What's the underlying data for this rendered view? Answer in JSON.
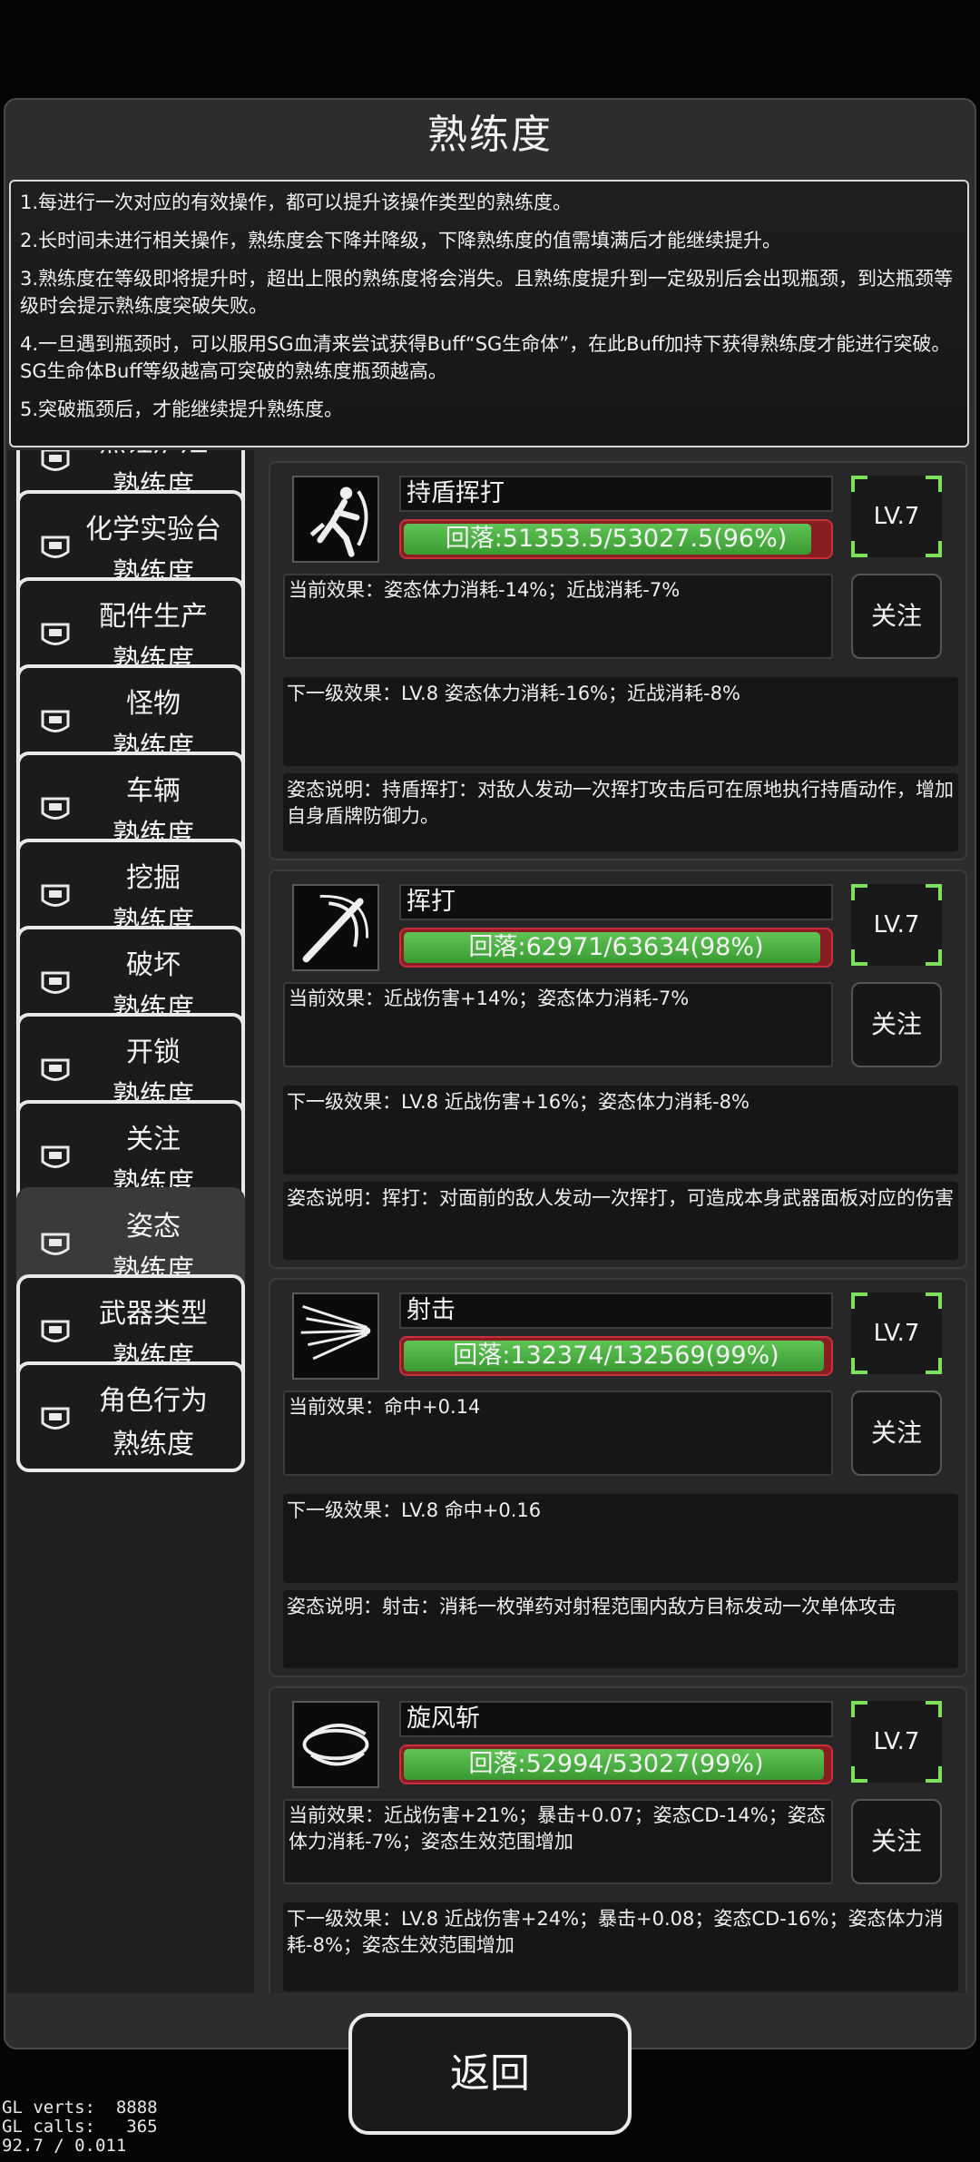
{
  "title": "熟练度",
  "info": [
    "1.每进行一次对应的有效操作，都可以提升该操作类型的熟练度。",
    "2.长时间未进行相关操作，熟练度会下降并降级，下降熟练度的值需填满后才能继续提升。",
    "3.熟练度在等级即将提升时，超出上限的熟练度将会消失。且熟练度提升到一定级别后会出现瓶颈，到达瓶颈等级时会提示熟练度突破失败。",
    "4.一旦遇到瓶颈时，可以服用SG血清来尝试获得Buff“SG生命体”，在此Buff加持下获得熟练度才能进行突破。SG生命体Buff等级越高可突破的熟练度瓶颈越高。",
    "5.突破瓶颈后，才能继续提升熟练度。"
  ],
  "categories": [
    {
      "l1": "烹饪炉灶",
      "l2": "熟练度",
      "active": false
    },
    {
      "l1": "化学实验台",
      "l2": "熟练度",
      "active": false
    },
    {
      "l1": "配件生产",
      "l2": "熟练度",
      "active": false
    },
    {
      "l1": "怪物",
      "l2": "熟练度",
      "active": false
    },
    {
      "l1": "车辆",
      "l2": "熟练度",
      "active": false
    },
    {
      "l1": "挖掘",
      "l2": "熟练度",
      "active": false
    },
    {
      "l1": "破坏",
      "l2": "熟练度",
      "active": false
    },
    {
      "l1": "开锁",
      "l2": "熟练度",
      "active": false
    },
    {
      "l1": "关注",
      "l2": "熟练度",
      "active": false
    },
    {
      "l1": "姿态",
      "l2": "熟练度",
      "active": true
    },
    {
      "l1": "武器类型",
      "l2": "熟练度",
      "active": false
    },
    {
      "l1": "角色行为",
      "l2": "熟练度",
      "active": false
    }
  ],
  "skills": [
    {
      "name": "持盾挥打",
      "icon": "shield-swing-icon",
      "progress_text": "回落:51353.5/53027.5(96%)",
      "progress": 0.96,
      "level": "LV.7",
      "current": "当前效果：姿态体力消耗-14%；近战消耗-7%",
      "follow": "关注",
      "next": "下一级效果：LV.8 姿态体力消耗-16%；近战消耗-8%",
      "desc": "姿态说明：持盾挥打：对敌人发动一次挥打攻击后可在原地执行持盾动作，增加自身盾牌防御力。"
    },
    {
      "name": "挥打",
      "icon": "swing-icon",
      "progress_text": "回落:62971/63634(98%)",
      "progress": 0.98,
      "level": "LV.7",
      "current": "当前效果：近战伤害+14%；姿态体力消耗-7%",
      "follow": "关注",
      "next": "下一级效果：LV.8 近战伤害+16%；姿态体力消耗-8%",
      "desc": "姿态说明：挥打：对面前的敌人发动一次挥打，可造成本身武器面板对应的伤害"
    },
    {
      "name": "射击",
      "icon": "shoot-icon",
      "progress_text": "回落:132374/132569(99%)",
      "progress": 0.99,
      "level": "LV.7",
      "current": "当前效果：命中+0.14",
      "follow": "关注",
      "next": "下一级效果：LV.8 命中+0.16",
      "desc": "姿态说明：射击：消耗一枚弹药对射程范围内敌方目标发动一次单体攻击"
    },
    {
      "name": "旋风斩",
      "icon": "whirlwind-icon",
      "progress_text": "回落:52994/53027(99%)",
      "progress": 0.99,
      "level": "LV.7",
      "current": "当前效果：近战伤害+21%；暴击+0.07；姿态CD-14%；姿态体力消耗-7%；姿态生效范围增加",
      "follow": "关注",
      "next": "下一级效果：LV.8 近战伤害+24%；暴击+0.08；姿态CD-16%；姿态体力消耗-8%；姿态生效范围增加",
      "desc": ""
    }
  ],
  "back": "返回",
  "debug": {
    "line1": "GL verts:  8888",
    "line2": "GL calls:   365",
    "line3": "92.7 / 0.011"
  }
}
